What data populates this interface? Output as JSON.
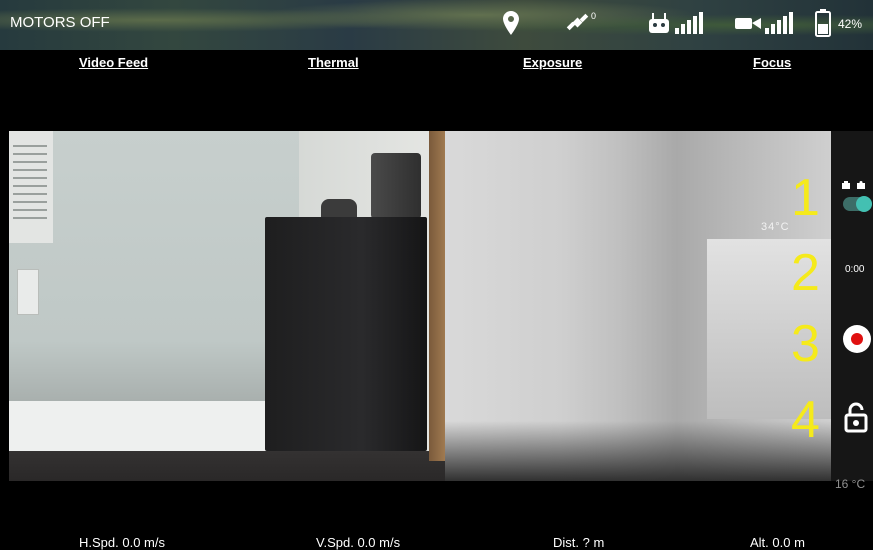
{
  "status_bar": {
    "motors": "MOTORS OFF",
    "satellite_count": "0",
    "battery_pct": "42%",
    "icons": [
      "location-pin-icon",
      "satellite-icon",
      "remote-controller-icon",
      "controller-signal-icon",
      "video-camera-icon",
      "video-signal-icon",
      "battery-icon"
    ]
  },
  "tabs": [
    "Video Feed",
    "Thermal",
    "Exposure",
    "Focus"
  ],
  "feed": {
    "thermal_spot_temp": "34°C"
  },
  "side_panel": {
    "callouts": [
      "1",
      "2",
      "3",
      "4"
    ],
    "record_timer": "0:00",
    "camera_temp": "16 °C",
    "toggle_on": true
  },
  "telemetry": {
    "h_speed": "H.Spd. 0.0 m/s",
    "v_speed": "V.Spd. 0.0 m/s",
    "distance": "Dist. ? m",
    "altitude": "Alt. 0.0 m"
  },
  "colors": {
    "callout_yellow": "#f5ea1b",
    "toggle_teal": "#43c0b2",
    "record_red": "#e01010"
  }
}
